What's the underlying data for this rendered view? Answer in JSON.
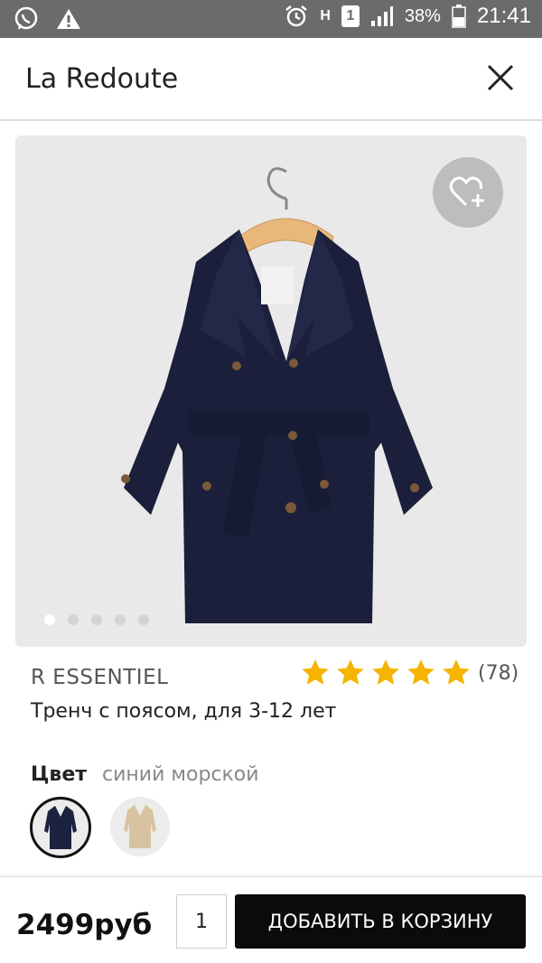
{
  "status_bar": {
    "battery_percent": "38%",
    "time": "21:41",
    "sim_slot": "1",
    "network_letter": "H",
    "icons": [
      "viber-icon",
      "warning-icon",
      "alarm-icon",
      "network-icon",
      "sim-icon",
      "signal-icon",
      "battery-icon"
    ]
  },
  "app_bar": {
    "title": "La Redoute",
    "close_icon": "close-icon"
  },
  "product": {
    "favorite_icon": "heart-plus-icon",
    "carousel": {
      "count": 5,
      "active_index": 0
    },
    "brand": "R ESSENTIEL",
    "rating": {
      "stars": 5,
      "max": 5,
      "count": "(78)",
      "star_color": "#f5b400"
    },
    "name": "Тренч с поясом, для 3-12 лет"
  },
  "color_picker": {
    "label": "Цвет",
    "selected_value": "синий морской",
    "swatches": [
      {
        "name": "navy",
        "color": "#1c2340",
        "selected": true
      },
      {
        "name": "beige",
        "color": "#d8c3a0",
        "selected": false
      }
    ]
  },
  "purchase": {
    "price": "2499руб",
    "quantity": "1",
    "add_to_cart_label": "ДОБАВИТЬ В КОРЗИНУ"
  }
}
